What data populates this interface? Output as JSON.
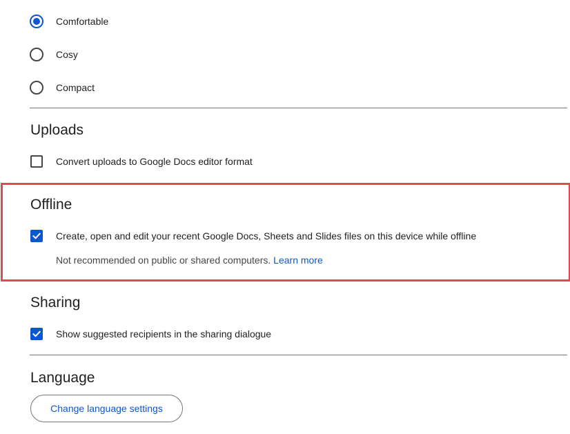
{
  "density": {
    "options": [
      {
        "label": "Comfortable",
        "selected": true
      },
      {
        "label": "Cosy",
        "selected": false
      },
      {
        "label": "Compact",
        "selected": false
      }
    ]
  },
  "uploads": {
    "title": "Uploads",
    "convert_label": "Convert uploads to Google Docs editor format",
    "convert_checked": false
  },
  "offline": {
    "title": "Offline",
    "enable_label": "Create, open and edit your recent Google Docs, Sheets and Slides files on this device while offline",
    "enable_checked": true,
    "note": "Not recommended on public or shared computers.",
    "learn_more": "Learn more",
    "highlight_color": "#e5474f"
  },
  "sharing": {
    "title": "Sharing",
    "suggested_label": "Show suggested recipients in the sharing dialogue",
    "suggested_checked": true
  },
  "language": {
    "title": "Language",
    "button_label": "Change language settings"
  },
  "colors": {
    "accent": "#0b57d0",
    "text": "#1f1f1f",
    "highlight": "#e5474f"
  }
}
